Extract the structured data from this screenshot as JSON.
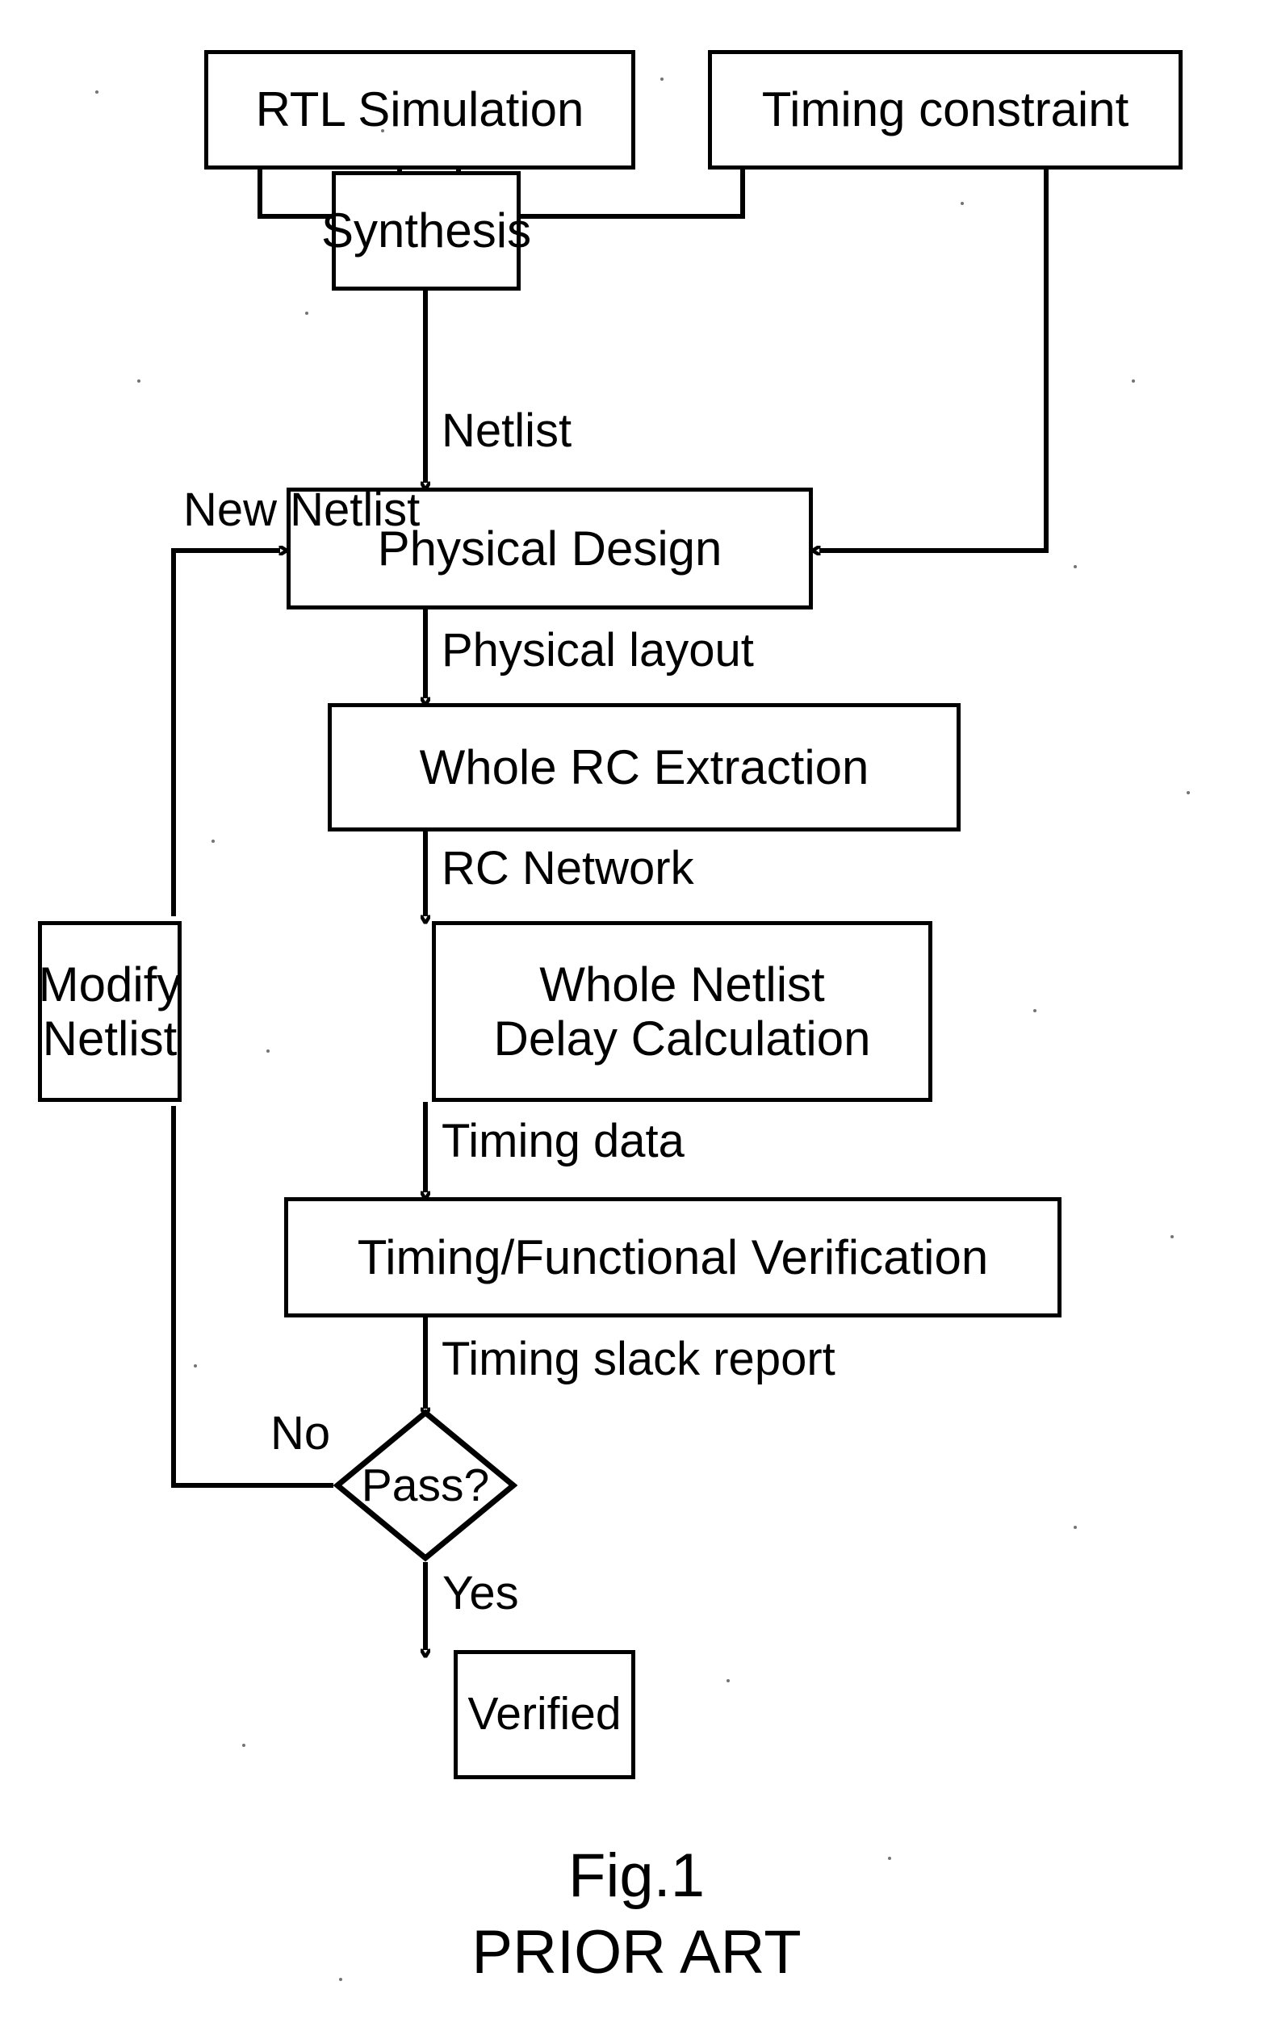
{
  "figure": {
    "caption_line1": "Fig.1",
    "caption_line2": "PRIOR ART",
    "line_color": "#000000",
    "background_color": "#ffffff"
  },
  "nodes": {
    "rtl_simulation": {
      "label": "RTL Simulation",
      "shape": "rect"
    },
    "timing_constraint": {
      "label": "Timing constraint",
      "shape": "rect"
    },
    "synthesis": {
      "label": "Synthesis",
      "shape": "rect"
    },
    "physical_design": {
      "label": "Physical Design",
      "shape": "rect"
    },
    "whole_rc_extraction": {
      "label": "Whole RC Extraction",
      "shape": "rect"
    },
    "modify_netlist": {
      "label": "Modify\nNetlist",
      "shape": "rect"
    },
    "whole_netlist_delay_calculation": {
      "label": "Whole Netlist\nDelay Calculation",
      "shape": "rect"
    },
    "timing_functional_verification": {
      "label": "Timing/Functional Verification",
      "shape": "rect"
    },
    "pass_decision": {
      "label": "Pass?",
      "shape": "diamond"
    },
    "verified": {
      "label": "Verified",
      "shape": "rect"
    }
  },
  "edge_labels": {
    "netlist": "Netlist",
    "new_netlist": "New Netlist",
    "physical_layout": "Physical layout",
    "rc_network": "RC Network",
    "timing_data": "Timing data",
    "timing_slack_report": "Timing slack report",
    "no": "No",
    "yes": "Yes"
  },
  "chart_data": {
    "type": "diagram",
    "title": "Fig.1 PRIOR ART",
    "nodes": [
      {
        "id": "rtl_simulation",
        "label": "RTL Simulation",
        "shape": "rect"
      },
      {
        "id": "timing_constraint",
        "label": "Timing constraint",
        "shape": "rect"
      },
      {
        "id": "synthesis",
        "label": "Synthesis",
        "shape": "rect"
      },
      {
        "id": "physical_design",
        "label": "Physical Design",
        "shape": "rect"
      },
      {
        "id": "whole_rc_extraction",
        "label": "Whole RC Extraction",
        "shape": "rect"
      },
      {
        "id": "whole_netlist_delay_calculation",
        "label": "Whole Netlist Delay Calculation",
        "shape": "rect"
      },
      {
        "id": "timing_functional_verification",
        "label": "Timing/Functional Verification",
        "shape": "rect"
      },
      {
        "id": "pass_decision",
        "label": "Pass?",
        "shape": "diamond"
      },
      {
        "id": "verified",
        "label": "Verified",
        "shape": "rect"
      },
      {
        "id": "modify_netlist",
        "label": "Modify Netlist",
        "shape": "rect"
      }
    ],
    "edges": [
      {
        "from": "rtl_simulation",
        "to": "synthesis",
        "label": ""
      },
      {
        "from": "timing_constraint",
        "to": "synthesis",
        "label": ""
      },
      {
        "from": "synthesis",
        "to": "physical_design",
        "label": "Netlist"
      },
      {
        "from": "timing_constraint",
        "to": "physical_design",
        "label": ""
      },
      {
        "from": "physical_design",
        "to": "whole_rc_extraction",
        "label": "Physical layout"
      },
      {
        "from": "whole_rc_extraction",
        "to": "whole_netlist_delay_calculation",
        "label": "RC Network"
      },
      {
        "from": "whole_netlist_delay_calculation",
        "to": "timing_functional_verification",
        "label": "Timing data"
      },
      {
        "from": "timing_functional_verification",
        "to": "pass_decision",
        "label": "Timing slack report"
      },
      {
        "from": "pass_decision",
        "to": "modify_netlist",
        "label": "No"
      },
      {
        "from": "pass_decision",
        "to": "verified",
        "label": "Yes"
      },
      {
        "from": "modify_netlist",
        "to": "physical_design",
        "label": "New Netlist"
      }
    ]
  }
}
